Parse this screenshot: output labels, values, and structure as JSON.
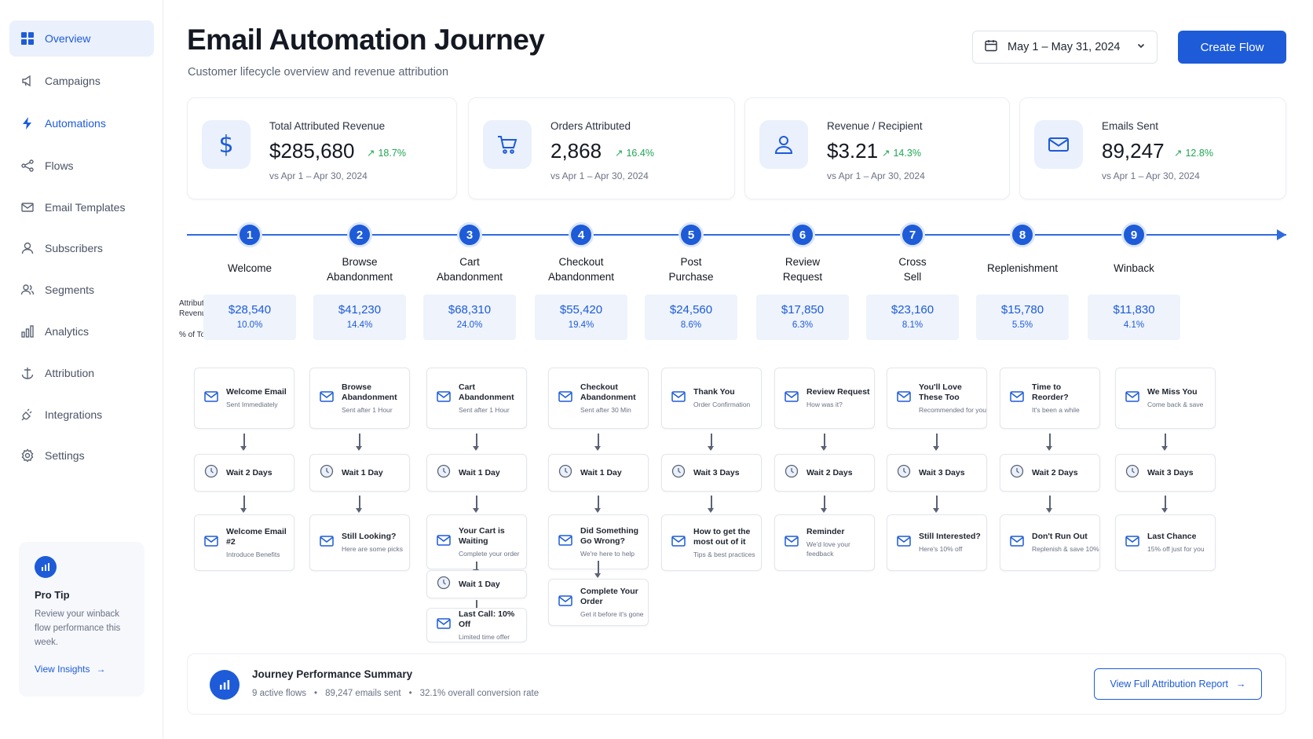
{
  "sidebar": {
    "items": [
      {
        "label": "Overview",
        "icon": "grid-icon"
      },
      {
        "label": "Campaigns",
        "icon": "megaphone-icon"
      },
      {
        "label": "Automations",
        "icon": "lightning-icon"
      },
      {
        "label": "Flows",
        "icon": "share-nodes-icon"
      },
      {
        "label": "Email Templates",
        "icon": "envelope-icon"
      },
      {
        "label": "Subscribers",
        "icon": "user-icon"
      },
      {
        "label": "Segments",
        "icon": "users-icon"
      },
      {
        "label": "Analytics",
        "icon": "bar-chart-icon"
      },
      {
        "label": "Attribution",
        "icon": "anchor-icon"
      },
      {
        "label": "Integrations",
        "icon": "plug-icon"
      },
      {
        "label": "Settings",
        "icon": "gear-icon"
      }
    ],
    "active": "Overview",
    "tip": {
      "title": "Pro Tip",
      "body": "Review your winback flow performance this week.",
      "link": "View Insights"
    }
  },
  "header": {
    "title": "Email Automation Journey",
    "subtitle": "Customer lifecycle overview and revenue attribution",
    "date_range": "May 1 – May 31, 2024",
    "create_button": "Create Flow"
  },
  "kpis": [
    {
      "label": "Total Attributed Revenue",
      "value": "$285,680",
      "delta": "18.7%",
      "compare": "vs Apr 1 – Apr 30, 2024",
      "icon": "dollar-icon"
    },
    {
      "label": "Orders Attributed",
      "value": "2,868",
      "delta": "16.4%",
      "compare": "vs Apr 1 – Apr 30, 2024",
      "icon": "cart-icon"
    },
    {
      "label": "Revenue / Recipient",
      "value": "$3.21",
      "delta": "14.3%",
      "compare": "vs Apr 1 – Apr 30, 2024",
      "icon": "person-icon"
    },
    {
      "label": "Emails Sent",
      "value": "89,247",
      "delta": "12.8%",
      "compare": "vs Apr 1 – Apr 30, 2024",
      "icon": "envelope-icon"
    }
  ],
  "journey": {
    "revenue_label_1": "Attributed",
    "revenue_label_2": "Revenue",
    "pct_label": "% of Total",
    "steps": [
      {
        "num": "1",
        "title": "Welcome",
        "revenue": "$28,540",
        "pct": "10.0%",
        "pct_value": 10.0
      },
      {
        "num": "2",
        "title": "Browse\nAbandonment",
        "revenue": "$41,230",
        "pct": "14.4%",
        "pct_value": 14.4
      },
      {
        "num": "3",
        "title": "Cart\nAbandonment",
        "revenue": "$68,310",
        "pct": "24.0%",
        "pct_value": 24.0
      },
      {
        "num": "4",
        "title": "Checkout\nAbandonment",
        "revenue": "$55,420",
        "pct": "19.4%",
        "pct_value": 19.4
      },
      {
        "num": "5",
        "title": "Post\nPurchase",
        "revenue": "$24,560",
        "pct": "8.6%",
        "pct_value": 8.6
      },
      {
        "num": "6",
        "title": "Review\nRequest",
        "revenue": "$17,850",
        "pct": "6.3%",
        "pct_value": 6.3
      },
      {
        "num": "7",
        "title": "Cross\nSell",
        "revenue": "$23,160",
        "pct": "8.1%",
        "pct_value": 8.1
      },
      {
        "num": "8",
        "title": "Replenishment",
        "revenue": "$15,780",
        "pct": "5.5%",
        "pct_value": 5.5
      },
      {
        "num": "9",
        "title": "Winback",
        "revenue": "$11,830",
        "pct": "4.1%",
        "pct_value": 4.1
      }
    ]
  },
  "flows": [
    {
      "email1": {
        "title": "Welcome Email",
        "sub": "Sent Immediately"
      },
      "wait": "Wait 2 Days",
      "email2": {
        "title": "Welcome Email #2",
        "sub": "Introduce Benefits"
      }
    },
    {
      "email1": {
        "title": "Browse Abandonment",
        "sub": "Sent after 1 Hour"
      },
      "wait": "Wait 1 Day",
      "email2": {
        "title": "Still Looking?",
        "sub": "Here are some picks"
      }
    },
    {
      "email1": {
        "title": "Cart Abandonment",
        "sub": "Sent after 1 Hour"
      },
      "wait": "Wait 1 Day",
      "email2": {
        "title": "Your Cart is Waiting",
        "sub": "Complete your order"
      },
      "wait2": "Wait 1 Day",
      "email3": {
        "title": "Last Call: 10% Off",
        "sub": "Limited time offer"
      }
    },
    {
      "email1": {
        "title": "Checkout Abandonment",
        "sub": "Sent after 30 Min"
      },
      "wait": "Wait 1 Day",
      "email2": {
        "title": "Did Something Go Wrong?",
        "sub": "We're here to help"
      },
      "email3": {
        "title": "Complete Your Order",
        "sub": "Get it before it's gone"
      }
    },
    {
      "email1": {
        "title": "Thank You",
        "sub": "Order Confirmation"
      },
      "wait": "Wait 3 Days",
      "email2": {
        "title": "How to get the most out of it",
        "sub": "Tips & best practices"
      }
    },
    {
      "email1": {
        "title": "Review Request",
        "sub": "How was it?"
      },
      "wait": "Wait 2 Days",
      "email2": {
        "title": "Reminder",
        "sub": "We'd love your feedback"
      }
    },
    {
      "email1": {
        "title": "You'll Love These Too",
        "sub": "Recommended for you"
      },
      "wait": "Wait 3 Days",
      "email2": {
        "title": "Still Interested?",
        "sub": "Here's 10% off"
      }
    },
    {
      "email1": {
        "title": "Time to Reorder?",
        "sub": "It's been a while"
      },
      "wait": "Wait 2 Days",
      "email2": {
        "title": "Don't Run Out",
        "sub": "Replenish & save 10%"
      }
    },
    {
      "email1": {
        "title": "We Miss You",
        "sub": "Come back & save"
      },
      "wait": "Wait 3 Days",
      "email2": {
        "title": "Last Chance",
        "sub": "15% off just for you"
      }
    }
  ],
  "summary": {
    "title": "Journey Performance Summary",
    "stats": [
      "9 active flows",
      "89,247 emails sent",
      "32.1% overall conversion rate"
    ],
    "button": "View Full Attribution Report"
  },
  "colors": {
    "accent": "#1d5bd8",
    "positive": "#1fa653",
    "card_bg": "#eaf0fc"
  }
}
